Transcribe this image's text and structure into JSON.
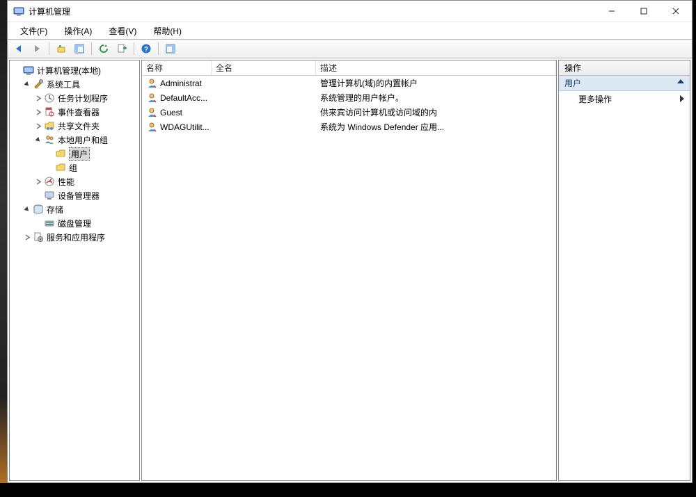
{
  "window": {
    "title": "计算机管理"
  },
  "menubar": {
    "file": "文件(F)",
    "action": "操作(A)",
    "view": "查看(V)",
    "help": "帮助(H)"
  },
  "tree": {
    "root": "计算机管理(本地)",
    "system_tools": "系统工具",
    "task_scheduler": "任务计划程序",
    "event_viewer": "事件查看器",
    "shared_folders": "共享文件夹",
    "local_users_groups": "本地用户和组",
    "users": "用户",
    "groups": "组",
    "performance": "性能",
    "device_manager": "设备管理器",
    "storage": "存储",
    "disk_management": "磁盘管理",
    "services_apps": "服务和应用程序"
  },
  "list": {
    "columns": {
      "name": "名称",
      "fullname": "全名",
      "description": "描述"
    },
    "rows": [
      {
        "name": "Administrat",
        "fullname": "",
        "description": "管理计算机(域)的内置帐户"
      },
      {
        "name": "DefaultAcc...",
        "fullname": "",
        "description": "系统管理的用户帐户。"
      },
      {
        "name": "Guest",
        "fullname": "",
        "description": "供来宾访问计算机或访问域的内"
      },
      {
        "name": "WDAGUtilit...",
        "fullname": "",
        "description": "系统为 Windows Defender 应用..."
      }
    ]
  },
  "actions": {
    "title": "操作",
    "section": "用户",
    "more": "更多操作"
  }
}
